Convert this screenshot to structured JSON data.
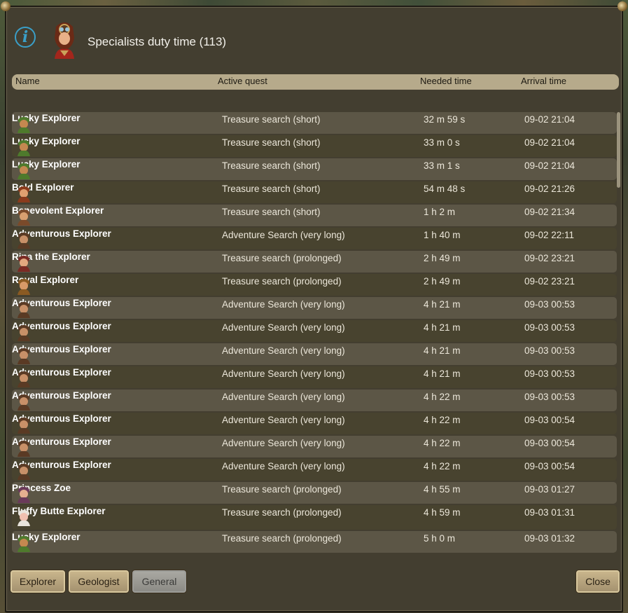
{
  "window": {
    "title": "Specialists duty time (113)",
    "info_icon": "info-icon",
    "portrait_icon": "specialist-portrait-icon"
  },
  "table": {
    "columns": [
      "Name",
      "Active quest",
      "Needed time",
      "Arrival time"
    ],
    "rows": [
      {
        "name": "Lucky Explorer",
        "quest": "Treasure search (short)",
        "needed": "32 m 59 s",
        "arrival": "09-02 21:04",
        "icon": "lucky-explorer-icon"
      },
      {
        "name": "Lucky Explorer",
        "quest": "Treasure search (short)",
        "needed": "33 m 0 s",
        "arrival": "09-02 21:04",
        "icon": "lucky-explorer-icon"
      },
      {
        "name": "Lucky Explorer",
        "quest": "Treasure search (short)",
        "needed": "33 m 1 s",
        "arrival": "09-02 21:04",
        "icon": "lucky-explorer-icon"
      },
      {
        "name": "Bold Explorer",
        "quest": "Treasure search (short)",
        "needed": "54 m 48 s",
        "arrival": "09-02 21:26",
        "icon": "bold-explorer-icon"
      },
      {
        "name": "Benevolent Explorer",
        "quest": "Treasure search (short)",
        "needed": "1 h 2 m",
        "arrival": "09-02 21:34",
        "icon": "benevolent-explorer-icon"
      },
      {
        "name": "Adventurous Explorer",
        "quest": "Adventure Search (very long)",
        "needed": "1 h 40 m",
        "arrival": "09-02 22:11",
        "icon": "adventurous-explorer-icon"
      },
      {
        "name": "Rina the Explorer",
        "quest": "Treasure search (prolonged)",
        "needed": "2 h 49 m",
        "arrival": "09-02 23:21",
        "icon": "rina-explorer-icon"
      },
      {
        "name": "Royal Explorer",
        "quest": "Treasure search (prolonged)",
        "needed": "2 h 49 m",
        "arrival": "09-02 23:21",
        "icon": "royal-explorer-icon"
      },
      {
        "name": "Adventurous Explorer",
        "quest": "Adventure Search (very long)",
        "needed": "4 h 21 m",
        "arrival": "09-03 00:53",
        "icon": "adventurous-explorer-icon"
      },
      {
        "name": "Adventurous Explorer",
        "quest": "Adventure Search (very long)",
        "needed": "4 h 21 m",
        "arrival": "09-03 00:53",
        "icon": "adventurous-explorer-icon"
      },
      {
        "name": "Adventurous Explorer",
        "quest": "Adventure Search (very long)",
        "needed": "4 h 21 m",
        "arrival": "09-03 00:53",
        "icon": "adventurous-explorer-icon"
      },
      {
        "name": "Adventurous Explorer",
        "quest": "Adventure Search (very long)",
        "needed": "4 h 21 m",
        "arrival": "09-03 00:53",
        "icon": "adventurous-explorer-icon"
      },
      {
        "name": "Adventurous Explorer",
        "quest": "Adventure Search (very long)",
        "needed": "4 h 22 m",
        "arrival": "09-03 00:53",
        "icon": "adventurous-explorer-icon"
      },
      {
        "name": "Adventurous Explorer",
        "quest": "Adventure Search (very long)",
        "needed": "4 h 22 m",
        "arrival": "09-03 00:54",
        "icon": "adventurous-explorer-icon"
      },
      {
        "name": "Adventurous Explorer",
        "quest": "Adventure Search (very long)",
        "needed": "4 h 22 m",
        "arrival": "09-03 00:54",
        "icon": "adventurous-explorer-icon"
      },
      {
        "name": "Adventurous Explorer",
        "quest": "Adventure Search (very long)",
        "needed": "4 h 22 m",
        "arrival": "09-03 00:54",
        "icon": "adventurous-explorer-icon"
      },
      {
        "name": "Princess Zoe",
        "quest": "Treasure search (prolonged)",
        "needed": "4 h 55 m",
        "arrival": "09-03 01:27",
        "icon": "princess-zoe-icon"
      },
      {
        "name": "Fluffy Butte Explorer",
        "quest": "Treasure search (prolonged)",
        "needed": "4 h 59 m",
        "arrival": "09-03 01:31",
        "icon": "fluffy-butte-explorer-icon"
      },
      {
        "name": "Lucky Explorer",
        "quest": "Treasure search (prolonged)",
        "needed": "5 h 0 m",
        "arrival": "09-03 01:32",
        "icon": "lucky-explorer-icon"
      }
    ]
  },
  "buttons": {
    "explorer": "Explorer",
    "geologist": "Geologist",
    "general": "General",
    "close": "Close"
  },
  "colors": {
    "row_odd": "#5c5646",
    "row_even": "#48432f",
    "accent_info": "#3a9fc8"
  }
}
